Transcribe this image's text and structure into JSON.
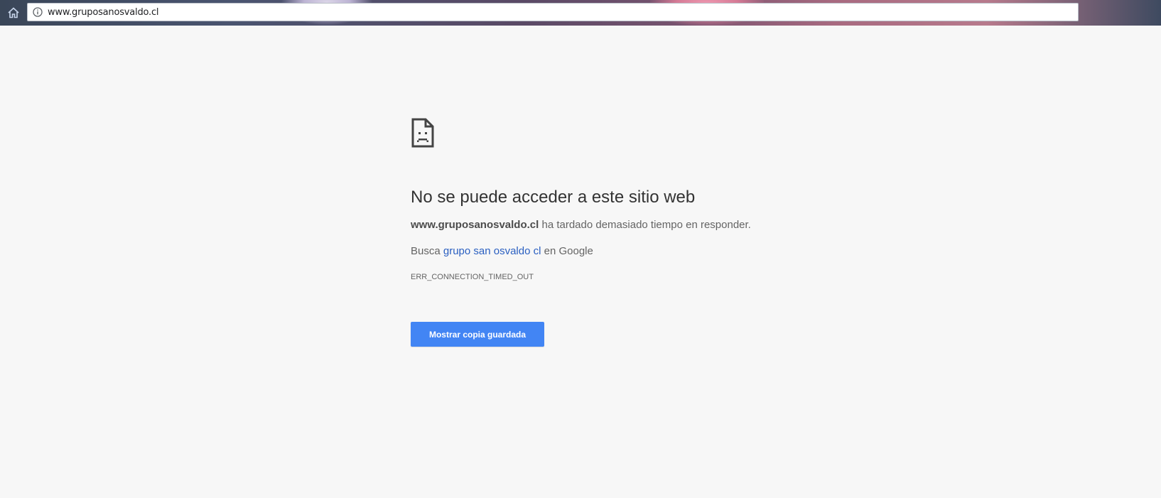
{
  "browser": {
    "url": "www.gruposanosvaldo.cl",
    "home_icon": "home-icon",
    "info_icon": "info-icon"
  },
  "error_page": {
    "icon": "sad-document-icon",
    "title": "No se puede acceder a este sitio web",
    "host": "www.gruposanosvaldo.cl",
    "description_suffix": " ha tardado demasiado tiempo en responder.",
    "search_prefix": "Busca ",
    "search_link": "grupo san osvaldo cl",
    "search_suffix": " en Google",
    "error_code": "ERR_CONNECTION_TIMED_OUT",
    "button_label": "Mostrar copia guardada",
    "button_color": "#4285f4"
  }
}
